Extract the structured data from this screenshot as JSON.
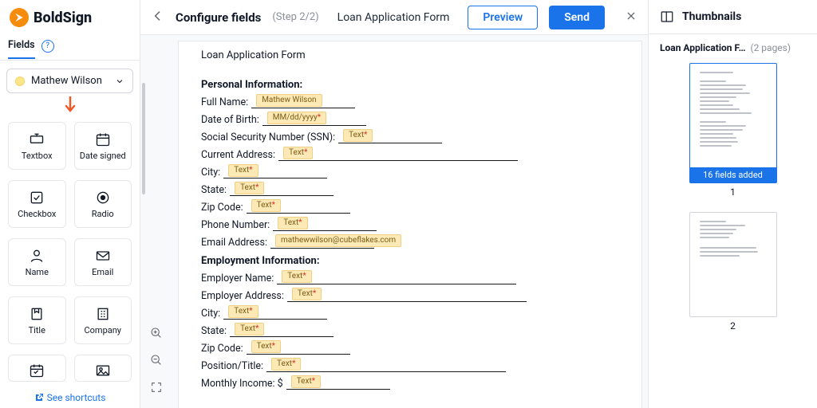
{
  "brand": "BoldSign",
  "sidebar": {
    "tab_label": "Fields",
    "help_char": "?",
    "signer_name": "Mathew Wilson",
    "tiles": [
      {
        "id": "textbox",
        "label": "Textbox"
      },
      {
        "id": "date-signed",
        "label": "Date signed"
      },
      {
        "id": "checkbox",
        "label": "Checkbox"
      },
      {
        "id": "radio",
        "label": "Radio"
      },
      {
        "id": "name",
        "label": "Name"
      },
      {
        "id": "email",
        "label": "Email"
      },
      {
        "id": "title",
        "label": "Title"
      },
      {
        "id": "company",
        "label": "Company"
      }
    ],
    "see_shortcuts": "See shortcuts"
  },
  "topbar": {
    "title": "Configure fields",
    "step": "(Step 2/2)",
    "doc_title": "Loan Application Form",
    "preview": "Preview",
    "send": "Send"
  },
  "doc": {
    "title": "Loan Application Form",
    "sec1": "Personal Information:",
    "sec2": "Employment Information:",
    "rows1": [
      {
        "label": "Full Name:",
        "pill": "Mathew Wilson",
        "req": false,
        "len": "short",
        "wide": false
      },
      {
        "label": "Date of Birth:",
        "pill": "MM/dd/yyyy",
        "req": true,
        "len": "short",
        "wide": false
      },
      {
        "label": "Social Security Number (SSN):",
        "pill": "Text",
        "req": true,
        "len": "short",
        "wide": false
      },
      {
        "label": "Current Address:",
        "pill": "Text",
        "req": true,
        "len": "long",
        "wide": false
      },
      {
        "label": "City:",
        "pill": "Text",
        "req": true,
        "len": "short",
        "wide": false
      },
      {
        "label": "State:",
        "pill": "Text",
        "req": true,
        "len": "short",
        "wide": false
      },
      {
        "label": "Zip Code:",
        "pill": "Text",
        "req": true,
        "len": "short",
        "wide": false
      },
      {
        "label": "Phone Number:",
        "pill": "Text",
        "req": true,
        "len": "short",
        "wide": false
      },
      {
        "label": "Email Address:",
        "pill": "mathewwilson@cubeflakes.com",
        "req": false,
        "len": "short",
        "wide": true
      }
    ],
    "rows2": [
      {
        "label": "Employer Name:",
        "pill": "Text",
        "req": true,
        "len": "long",
        "wide": false
      },
      {
        "label": "Employer Address:",
        "pill": "Text",
        "req": true,
        "len": "long",
        "wide": false
      },
      {
        "label": "City:",
        "pill": "Text",
        "req": true,
        "len": "short",
        "wide": false
      },
      {
        "label": "State:",
        "pill": "Text",
        "req": true,
        "len": "short",
        "wide": false
      },
      {
        "label": "Zip Code:",
        "pill": "Text",
        "req": true,
        "len": "short",
        "wide": false
      },
      {
        "label": "Position/Title:",
        "pill": "Text",
        "req": true,
        "len": "long",
        "wide": false
      },
      {
        "label": "Monthly Income: $",
        "pill": "Text",
        "req": true,
        "len": "short",
        "wide": false
      }
    ]
  },
  "thumbs": {
    "heading": "Thumbnails",
    "doc_name": "Loan Application F…",
    "pages_label": "(2 pages)",
    "badge": "16 fields added",
    "p1": "1",
    "p2": "2"
  }
}
